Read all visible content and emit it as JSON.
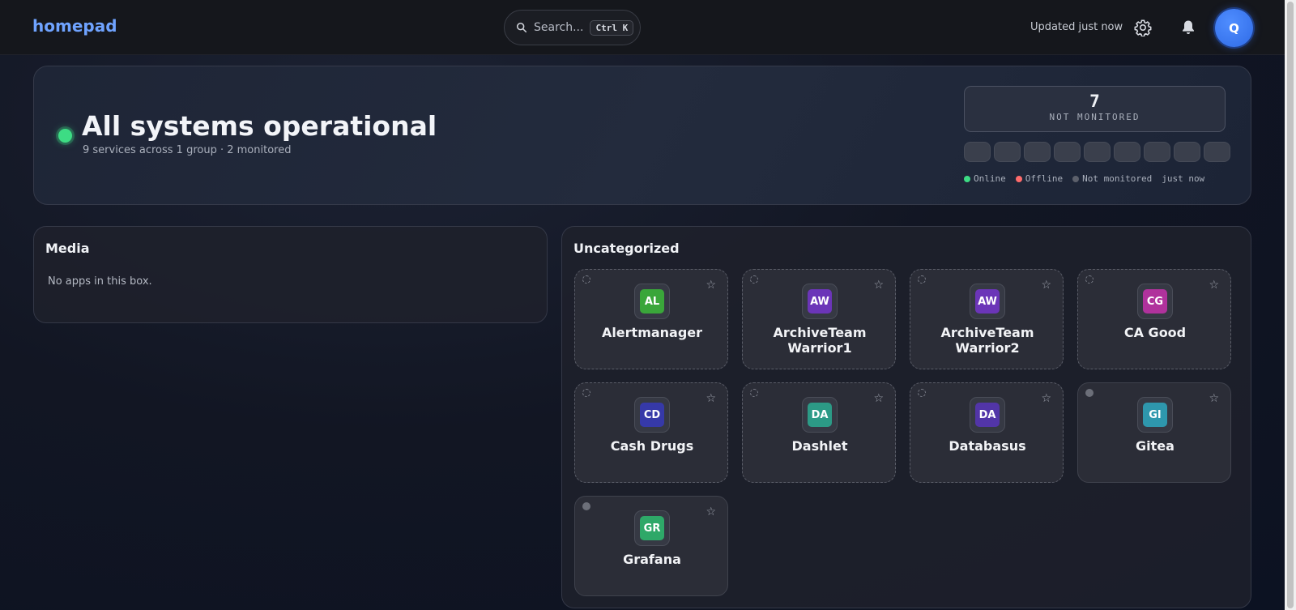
{
  "header": {
    "brand": "homepad",
    "search_placeholder": "Search...",
    "search_shortcut": "Ctrl K",
    "updated_text": "Updated just now",
    "avatar_initial": "Q"
  },
  "hero": {
    "title": "All systems operational",
    "subtitle": "9 services across 1 group · 2 monitored",
    "counter_value": "7",
    "counter_label": "NOT MONITORED",
    "legend": [
      {
        "label": "Online",
        "color": "#3ddc84"
      },
      {
        "label": "Offline",
        "color": "#ff6b6b"
      },
      {
        "label": "Not monitored",
        "color": "#5c606b"
      }
    ],
    "legend_time": "just now",
    "status_color": "#3ddc84"
  },
  "groups": [
    {
      "title": "Media",
      "empty_text": "No apps in this box."
    },
    {
      "title": "Uncategorized",
      "apps": [
        {
          "initials": "AL",
          "name": "Alertmanager",
          "color": "#3aa63a",
          "monitored": false
        },
        {
          "initials": "AW",
          "name": "ArchiveTeam Warrior1",
          "color": "#6b35b8",
          "monitored": false
        },
        {
          "initials": "AW",
          "name": "ArchiveTeam Warrior2",
          "color": "#6b35b8",
          "monitored": false
        },
        {
          "initials": "CG",
          "name": "CA Good",
          "color": "#b0329c",
          "monitored": false
        },
        {
          "initials": "CD",
          "name": "Cash Drugs",
          "color": "#3639a8",
          "monitored": false
        },
        {
          "initials": "DA",
          "name": "Dashlet",
          "color": "#2c9a86",
          "monitored": false
        },
        {
          "initials": "DA",
          "name": "Databasus",
          "color": "#5235a8",
          "monitored": false
        },
        {
          "initials": "GI",
          "name": "Gitea",
          "color": "#2e97ad",
          "monitored": true
        },
        {
          "initials": "GR",
          "name": "Grafana",
          "color": "#2ea868",
          "monitored": true
        }
      ]
    }
  ]
}
